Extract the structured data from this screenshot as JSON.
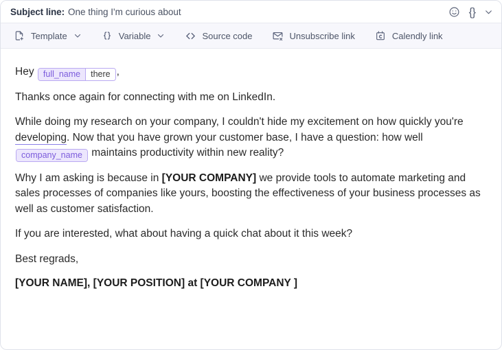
{
  "window": {
    "accent_purple": "#7c5cdc",
    "chip_bg": "#ece6fd",
    "chip_border": "#b9a9f2",
    "toolbar_bg": "#f7f7fc"
  },
  "subject": {
    "label": "Subject line:",
    "value": "One thing I'm curious about",
    "placeholder": "Subject line",
    "actions": [
      {
        "name": "emoji-icon",
        "label": "Emoji"
      },
      {
        "name": "variable-braces-icon",
        "label": "{}"
      },
      {
        "name": "chevron-down-icon",
        "label": "Expand"
      }
    ]
  },
  "toolbar": {
    "items": [
      {
        "icon": "file-plus-icon",
        "label": "Template",
        "caret": true
      },
      {
        "icon": "braces-icon",
        "label": "Variable",
        "caret": true
      },
      {
        "icon": "code-brackets-icon",
        "label": "Source code",
        "caret": false
      },
      {
        "icon": "envelope-x-icon",
        "label": "Unsubscribe link",
        "caret": false
      },
      {
        "icon": "calendar-c-icon",
        "label": "Calendly link",
        "caret": false
      }
    ]
  },
  "body": {
    "greeting": {
      "lead": "Hey",
      "chip": {
        "key": "full_name",
        "fallback": "there"
      },
      "trail": ","
    },
    "p1": "Thanks once again for connecting with me on LinkedIn.",
    "p2": {
      "part1": "While doing my research on your company, I couldn't hide my excitement on how quickly you're ",
      "misspelled": "developing",
      "part2": ". Now that you have grown your customer base, I have a question: how well ",
      "chip": {
        "key": "company_name"
      },
      "part3": " maintains productivity within new reality?"
    },
    "p3": {
      "part1": "Why I am asking is because in ",
      "bold": "[YOUR COMPANY]",
      "part2": " we provide tools to automate marketing and sales processes of companies like yours, boosting the effectiveness of your business processes as well as customer satisfaction."
    },
    "p4": "If you are interested, what about having a quick chat about it this week?",
    "p5": "Best regrads,",
    "signature": "[YOUR NAME], [YOUR POSITION] at [YOUR COMPANY ]"
  }
}
